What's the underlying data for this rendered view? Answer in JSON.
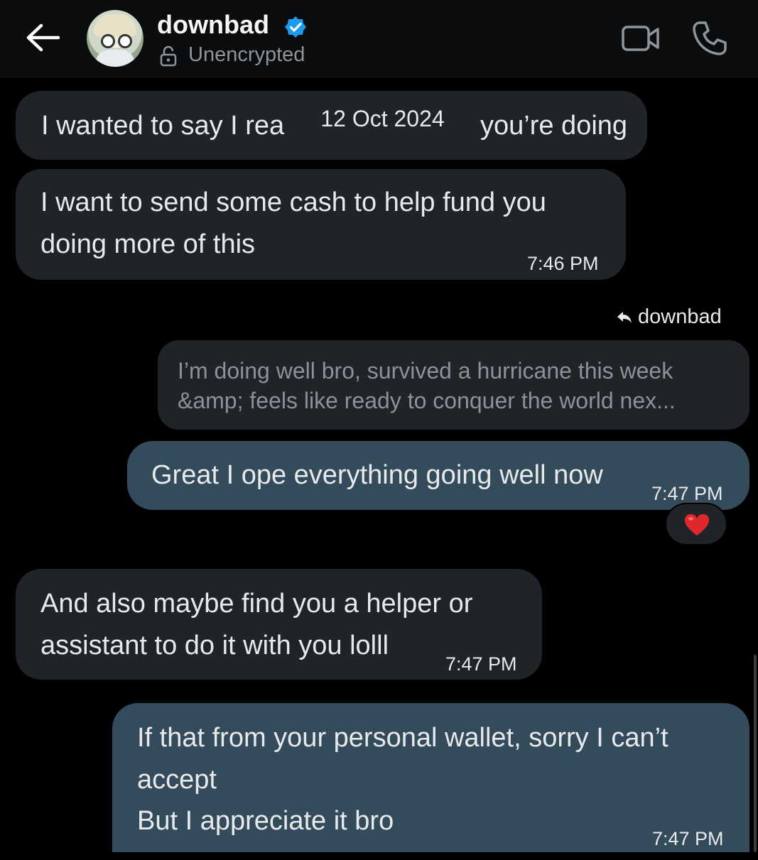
{
  "header": {
    "contact_name": "downbad",
    "encryption_status": "Unencrypted",
    "icons": {
      "back": "arrow-left-icon",
      "verified": "verified-badge-icon",
      "lock": "open-lock-icon",
      "video": "video-call-icon",
      "phone": "phone-call-icon"
    }
  },
  "date_separator": "12 Oct 2024",
  "messages": [
    {
      "side": "incoming",
      "text": "I wanted to say I rea",
      "text_end": "you’re doing"
    },
    {
      "side": "incoming",
      "line1": "I want to send some cash to help fund you",
      "line2": "doing more of this",
      "time": "7:46 PM"
    },
    {
      "side": "outgoing",
      "reply_to": "downbad",
      "quoted_line1": "I’m doing well bro, survived a hurricane this week",
      "quoted_line2": "&amp; feels like ready to conquer the world nex...",
      "text": "Great I ope everything going well now",
      "time": "7:47 PM",
      "reaction": "❤️"
    },
    {
      "side": "incoming",
      "line1": "And also maybe find you a helper or",
      "line2": "assistant to do it with you lolll",
      "time": "7:47 PM"
    },
    {
      "side": "outgoing",
      "line1": "If that from your personal wallet, sorry I can’t",
      "line2": "accept",
      "line3": "But I appreciate it bro",
      "time": "7:47 PM"
    }
  ],
  "colors": {
    "background": "#000000",
    "incoming_bubble": "#202327",
    "outgoing_bubble": "#344b5c",
    "verified_blue": "#1d9bf0",
    "muted_text": "#8b9298"
  }
}
